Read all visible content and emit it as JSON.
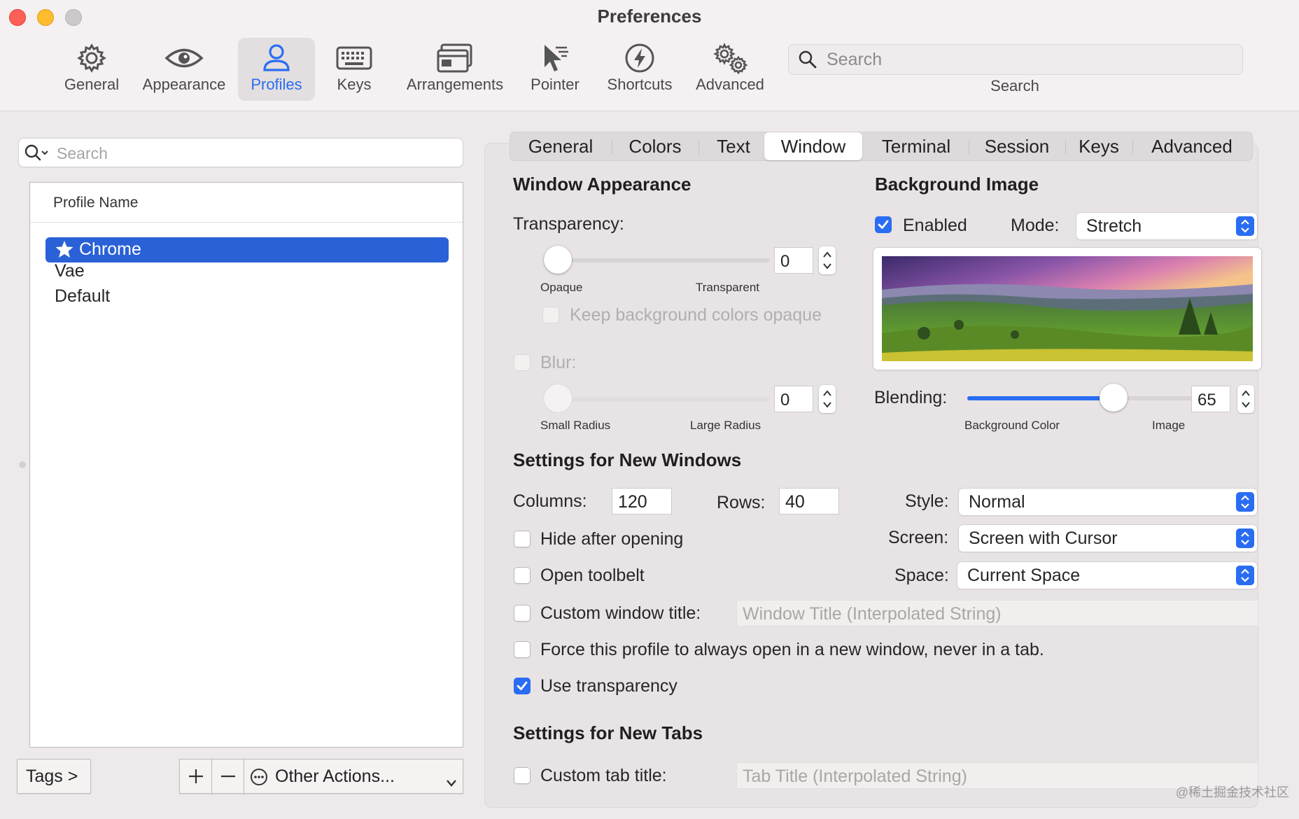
{
  "window": {
    "title": "Preferences"
  },
  "toolbar": {
    "items": [
      {
        "label": "General",
        "icon": "gear-icon"
      },
      {
        "label": "Appearance",
        "icon": "eye-icon"
      },
      {
        "label": "Profiles",
        "icon": "person-icon",
        "selected": true
      },
      {
        "label": "Keys",
        "icon": "keyboard-icon"
      },
      {
        "label": "Arrangements",
        "icon": "windows-icon"
      },
      {
        "label": "Pointer",
        "icon": "pointer-icon"
      },
      {
        "label": "Shortcuts",
        "icon": "bolt-icon"
      },
      {
        "label": "Advanced",
        "icon": "gears-icon"
      }
    ],
    "search": {
      "placeholder": "Search",
      "caption": "Search"
    }
  },
  "profiles": {
    "search_placeholder": "Search",
    "header": "Profile Name",
    "items": [
      {
        "name": "Chrome",
        "default": true,
        "selected": true
      },
      {
        "name": "Vae"
      },
      {
        "name": "Default"
      }
    ],
    "tags_label": "Tags >",
    "add_label": "+",
    "remove_label": "−",
    "other_actions_label": "Other Actions..."
  },
  "tabs": [
    "General",
    "Colors",
    "Text",
    "Window",
    "Terminal",
    "Session",
    "Keys",
    "Advanced"
  ],
  "selected_tab": "Window",
  "window_appearance": {
    "title": "Window Appearance",
    "transparency_label": "Transparency:",
    "transparency_value": "0",
    "transparency_min_label": "Opaque",
    "transparency_max_label": "Transparent",
    "keep_bg_opaque_label": "Keep background colors opaque",
    "blur_label": "Blur:",
    "blur_value": "0",
    "blur_min_label": "Small Radius",
    "blur_max_label": "Large Radius"
  },
  "background_image": {
    "title": "Background Image",
    "enabled_label": "Enabled",
    "enabled": true,
    "mode_label": "Mode:",
    "mode_value": "Stretch",
    "blending_label": "Blending:",
    "blending_value": "65",
    "blending_fraction": 0.65,
    "blending_min_label": "Background Color",
    "blending_max_label": "Image"
  },
  "new_windows": {
    "title": "Settings for New Windows",
    "columns_label": "Columns:",
    "columns_value": "120",
    "rows_label": "Rows:",
    "rows_value": "40",
    "style_label": "Style:",
    "style_value": "Normal",
    "screen_label": "Screen:",
    "screen_value": "Screen with Cursor",
    "space_label": "Space:",
    "space_value": "Current Space",
    "hide_after_opening_label": "Hide after opening",
    "open_toolbelt_label": "Open toolbelt",
    "custom_window_title_label": "Custom window title:",
    "custom_window_title_placeholder": "Window Title (Interpolated String)",
    "force_new_window_label": "Force this profile to always open in a new window, never in a tab.",
    "use_transparency_label": "Use transparency",
    "use_transparency": true
  },
  "new_tabs": {
    "title": "Settings for New Tabs",
    "custom_tab_title_label": "Custom tab title:",
    "custom_tab_title_placeholder": "Tab Title (Interpolated String)"
  },
  "watermark": "@稀土掘金技术社区",
  "colors": {
    "accent": "#2a6df2",
    "selection": "#2b61d6",
    "close": "#fe5f57",
    "minimize": "#febc2e",
    "zoom": "#cdc8c9"
  }
}
